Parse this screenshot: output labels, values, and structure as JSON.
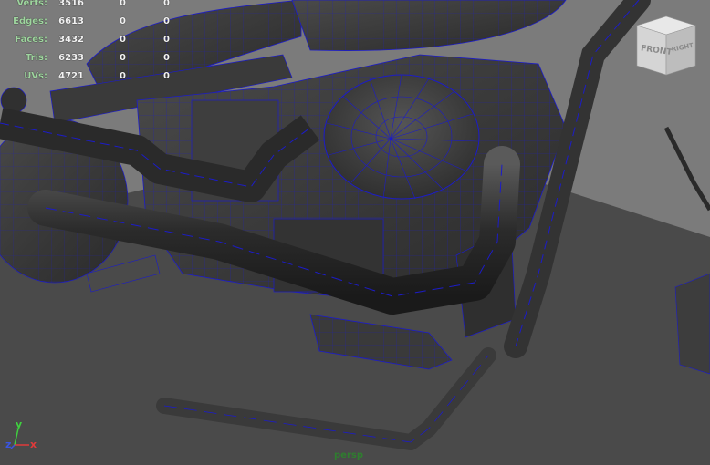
{
  "hud": {
    "rows": [
      {
        "label": "Verts:",
        "c1": "3516",
        "c2": "0",
        "c3": "0"
      },
      {
        "label": "Edges:",
        "c1": "6613",
        "c2": "0",
        "c3": "0"
      },
      {
        "label": "Faces:",
        "c1": "3432",
        "c2": "0",
        "c3": "0"
      },
      {
        "label": "Tris:",
        "c1": "6233",
        "c2": "0",
        "c3": "0"
      },
      {
        "label": "UVs:",
        "c1": "4721",
        "c2": "0",
        "c3": "0"
      }
    ]
  },
  "viewport": {
    "camera_label": "persp",
    "view_cube": {
      "front": "FRONT",
      "right": "RIGHT"
    },
    "axis": {
      "x": "x",
      "y": "y",
      "z": "z"
    }
  },
  "colors": {
    "background": "#7b7b7b",
    "floor": "#4a4a4a",
    "wireframe": "#1c1cc8",
    "mesh": "#3c3c3c",
    "hud_label": "#9fd59f",
    "hud_value": "#f2f2f2",
    "camera_label": "#2f7d2f"
  }
}
